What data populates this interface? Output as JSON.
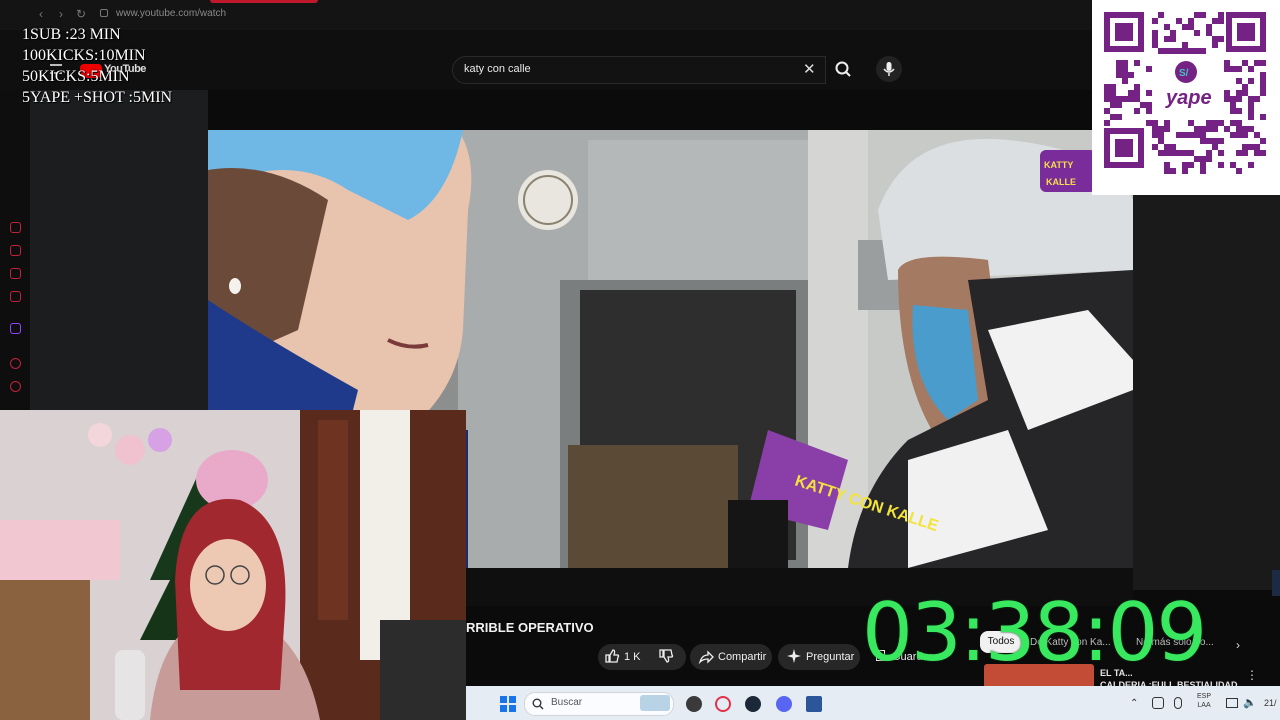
{
  "browser": {
    "url": "www.youtube.com/watch",
    "nav": {
      "back": "‹",
      "forward": "›",
      "reload": "↻"
    }
  },
  "youtube": {
    "logo_label": "YouTube",
    "search": {
      "value": "katy con calle",
      "clear_icon": "close-icon",
      "search_icon": "search-icon",
      "mic_icon": "mic-icon"
    }
  },
  "overlay": {
    "goals": [
      "1SUB :23 MIN",
      "100KICKS:10MIN",
      "50KICKS:5MIN",
      "5YAPE +SHOT :5MIN"
    ]
  },
  "video": {
    "title": "RRIBLE OPERATIVO",
    "channel_logo_text": "KATTY CON KALLE",
    "mic_text": "KATTY CON KALLE",
    "actions": {
      "like_count": "1 K",
      "share": "Compartir",
      "ask": "Preguntar",
      "save": "Guardar"
    }
  },
  "recommendations": {
    "chips": [
      "Todos",
      "De Katty con Ka...",
      "No más solo po..."
    ],
    "item_title": "EL TA...",
    "item_subtitle": "CALDERIA :FULL BESTIALIDAD"
  },
  "timer": {
    "value": "03:38:09",
    "color": "#38e85e"
  },
  "taskbar": {
    "search_label": "Buscar",
    "lang": [
      "ESP",
      "LAA"
    ],
    "clock": "21/"
  },
  "qr": {
    "brand": "yape",
    "badge": "S/"
  },
  "colors": {
    "accent": "#c0182b",
    "yape": "#742284",
    "timer": "#38e85e"
  }
}
